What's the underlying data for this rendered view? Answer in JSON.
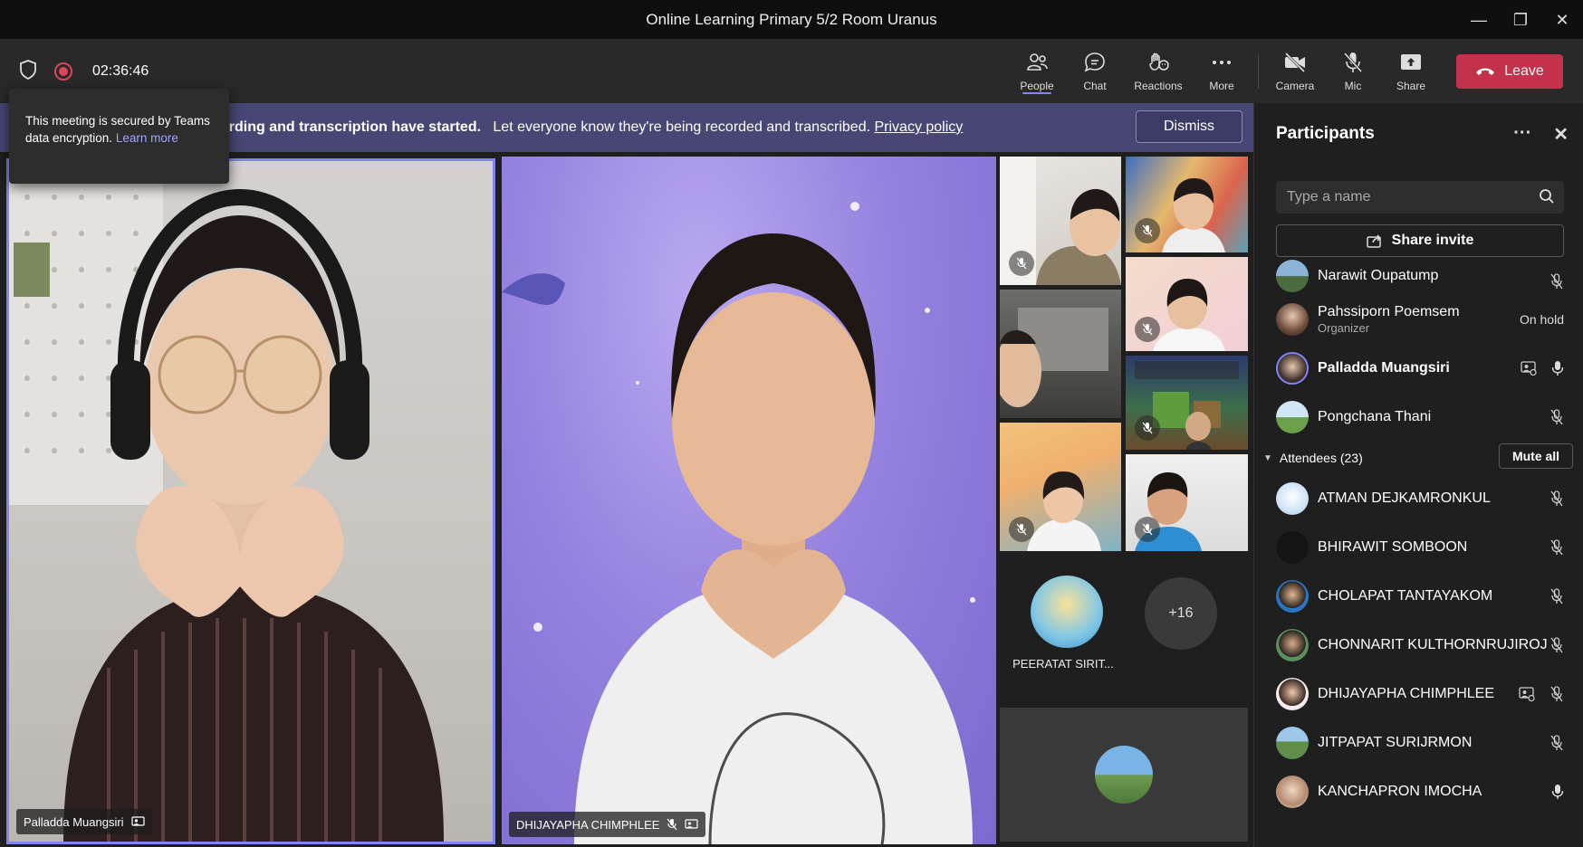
{
  "window": {
    "title": "Online Learning Primary 5/2 Room Uranus",
    "minimize": "—",
    "restore": "❐",
    "close": "✕"
  },
  "toolbar": {
    "timer": "02:36:46",
    "buttons": [
      {
        "label": "People",
        "icon": "people-icon"
      },
      {
        "label": "Chat",
        "icon": "chat-icon"
      },
      {
        "label": "Reactions",
        "icon": "reactions-icon"
      },
      {
        "label": "More",
        "icon": "more-icon"
      },
      {
        "label": "Camera",
        "icon": "camera-off-icon"
      },
      {
        "label": "Mic",
        "icon": "mic-off-icon"
      },
      {
        "label": "Share",
        "icon": "share-icon"
      }
    ],
    "leave_label": "Leave"
  },
  "banner": {
    "bold_text": "ording and transcription have started.",
    "text": "Let everyone know they're being recorded and transcribed.",
    "link": "Privacy policy",
    "dismiss_label": "Dismiss"
  },
  "tooltip": {
    "text": "This meeting is secured by Teams data encryption.",
    "link": "Learn more"
  },
  "stage": {
    "main_tiles": [
      {
        "name": "Palladda Muangsiri"
      },
      {
        "name": "DHIJAYAPHA CHIMPHLEE"
      }
    ],
    "avatar_tile": {
      "name": "PEERATAT SIRIT..."
    },
    "overflow_count": "+16"
  },
  "panel": {
    "title": "Participants",
    "search_placeholder": "Type a name",
    "share_invite": "Share invite",
    "presenters": [
      {
        "name": "Narawit Oupatump",
        "role": "",
        "status": ""
      },
      {
        "name": "Pahssiporn Poemsem",
        "role": "Organizer",
        "status": "On hold"
      },
      {
        "name": "Palladda Muangsiri",
        "role": "",
        "status": ""
      },
      {
        "name": "Pongchana Thani",
        "role": "",
        "status": ""
      }
    ],
    "attendees_label": "Attendees (23)",
    "mute_all": "Mute all",
    "attendees": [
      {
        "name": "ATMAN DEJKAMRONKUL"
      },
      {
        "name": "BHIRAWIT SOMBOON"
      },
      {
        "name": "CHOLAPAT TANTAYAKOM"
      },
      {
        "name": "CHONNARIT KULTHORNRUJIROJ"
      },
      {
        "name": "DHIJAYAPHA CHIMPHLEE"
      },
      {
        "name": "JITPAPAT SURIJRMON"
      },
      {
        "name": "KANCHAPRON IMOCHA"
      }
    ]
  },
  "colors": {
    "accent": "#7f85f5",
    "leave": "#c4314b",
    "banner": "#464775",
    "panel": "#1f1f1f"
  }
}
